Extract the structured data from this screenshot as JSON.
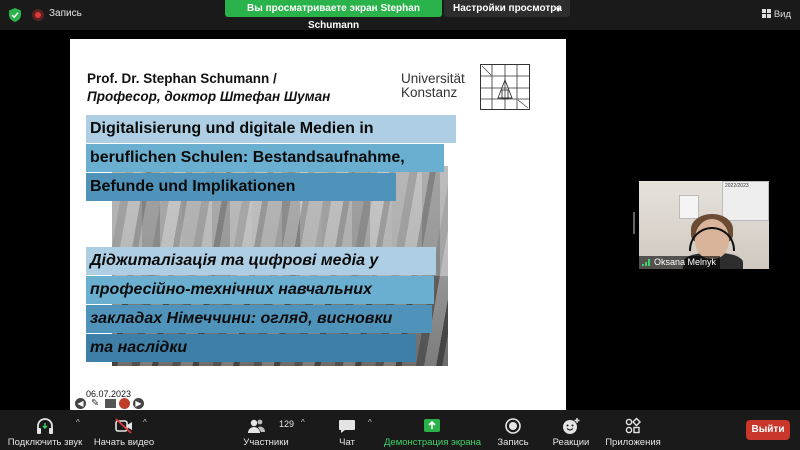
{
  "top_bar": {
    "recording_label": "Запись",
    "share_banner": "Вы просматриваете экран Stephan Schumann",
    "view_options_label": "Настройки просмотра",
    "view_button_label": "Вид"
  },
  "slide": {
    "presenter_line_1": "Prof. Dr. Stephan Schumann /",
    "presenter_line_2": "Професор, доктор Штефан Шуман",
    "university_line_1": "Universität",
    "university_line_2": "Konstanz",
    "title_de": [
      "Digitalisierung und digitale Medien in",
      "beruflichen Schulen: Bestandsaufnahme,",
      "Befunde und Implikationen"
    ],
    "title_ua": [
      "Діджиталізація та цифрові медіа у",
      "професійно-технічних навчальних",
      "закладах Німеччини: огляд, висновки",
      "та наслідки"
    ],
    "date": "06.07.2023"
  },
  "participant": {
    "name": "Oksana Melnyk",
    "board_text": "2022/2023"
  },
  "toolbar": {
    "audio_label": "Подключить звук",
    "video_label": "Начать видео",
    "participants_label": "Участники",
    "participants_count": "129",
    "chat_label": "Чат",
    "share_label": "Демонстрация экрана",
    "record_label": "Запись",
    "reactions_label": "Реакции",
    "apps_label": "Приложения",
    "leave_label": "Выйти"
  },
  "colors": {
    "share_green": "#2ab34a",
    "leave_red": "#c9372c",
    "band_light": "#aecfe3",
    "band_mid": "#6aaed0",
    "band_dark": "#4f93bb"
  }
}
